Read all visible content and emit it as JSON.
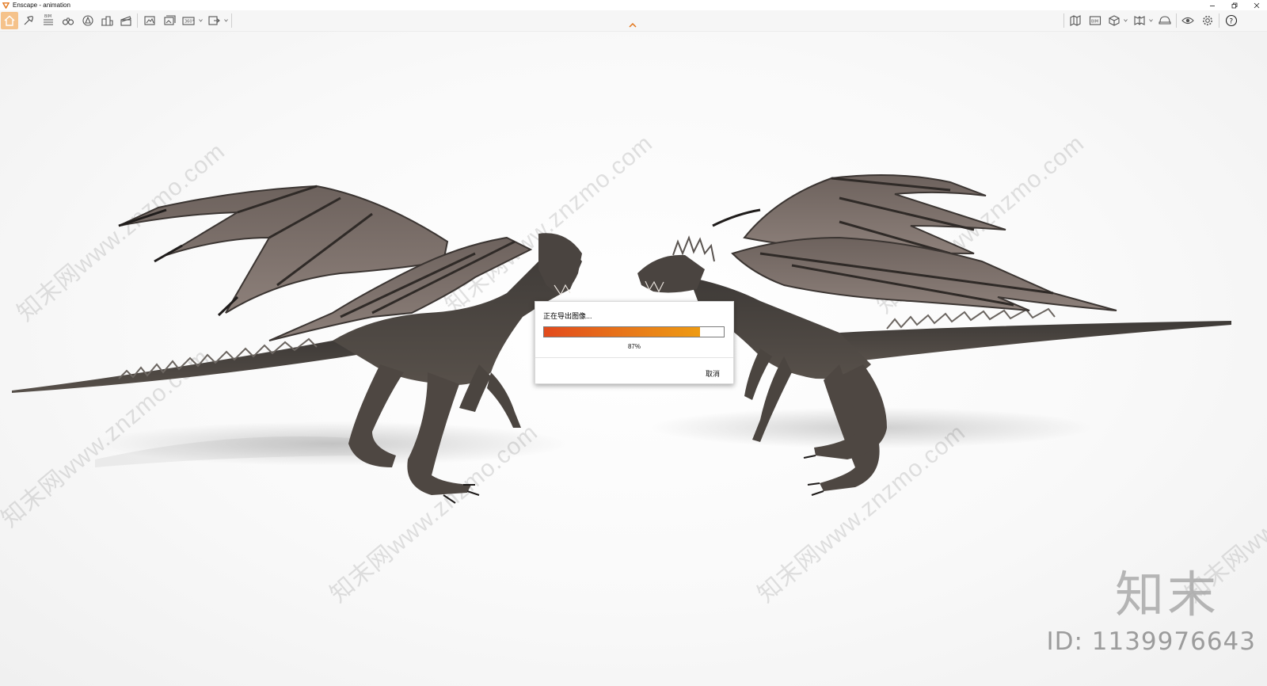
{
  "window": {
    "title": "Enscape - animation",
    "controls": [
      "minimize-icon",
      "restore-icon",
      "close-icon"
    ]
  },
  "toolbar": {
    "left_items": [
      {
        "name": "home-icon",
        "active": true
      },
      {
        "name": "asset-library-icon"
      },
      {
        "name": "bim-icon",
        "label": "BIM"
      },
      {
        "name": "binoculars-icon"
      },
      {
        "name": "artificial-light-icon"
      },
      {
        "name": "buildings-icon"
      },
      {
        "name": "clapperboard-icon"
      },
      {
        "name": "screenshot-icon"
      },
      {
        "name": "batch-render-icon"
      },
      {
        "name": "panorama-icon",
        "label": "360°"
      },
      {
        "name": "export-icon"
      }
    ],
    "right_items": [
      {
        "name": "map-icon"
      },
      {
        "name": "bim-panel-icon",
        "label": "BIM"
      },
      {
        "name": "cube-icon"
      },
      {
        "name": "book-icon"
      },
      {
        "name": "helmet-icon"
      },
      {
        "name": "eye-icon"
      },
      {
        "name": "settings-icon"
      },
      {
        "name": "help-icon"
      }
    ],
    "accent_color": "#f5c28a"
  },
  "viewport": {
    "watermark_text": "知末网www.znzmo.com",
    "brand_logo": "知末",
    "brand_id": "ID: 1139976643"
  },
  "export_dialog": {
    "title": "正在导出图像...",
    "progress": 0.87,
    "progress_text": "87%",
    "cancel_label": "取消",
    "progress_colors": [
      "#e24a1c",
      "#ee9b12"
    ]
  }
}
